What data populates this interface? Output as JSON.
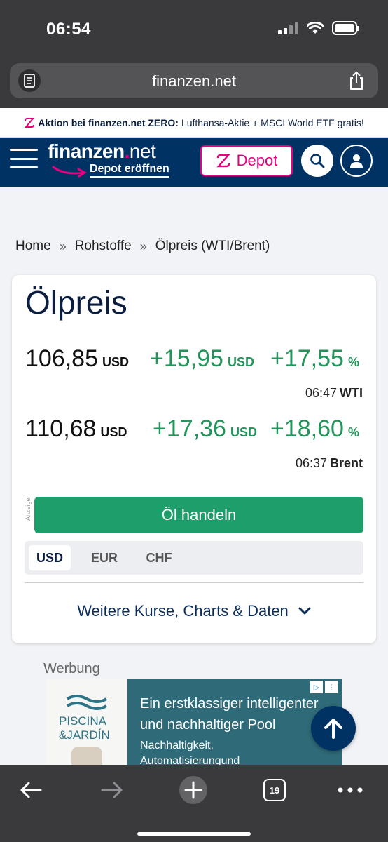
{
  "status": {
    "time": "06:54"
  },
  "browser": {
    "url": "finanzen.net",
    "tabs_count": "19"
  },
  "promo": {
    "bold": "Aktion bei finanzen.net ZERO:",
    "text": "Lufthansa-Aktie + MSCI World ETF gratis!"
  },
  "header": {
    "logo_main": "finanzen",
    "logo_dot": ".",
    "logo_net": "net",
    "logo_sub": "Depot eröffnen",
    "depot_label": "Depot"
  },
  "breadcrumb": [
    "Home",
    "Rohstoffe",
    "Ölpreis (WTI/Brent)"
  ],
  "breadcrumb_sep": "»",
  "card": {
    "title": "Ölpreis",
    "quotes": [
      {
        "price": "106,85",
        "price_unit": "USD",
        "change": "+15,95",
        "change_unit": "USD",
        "pct": "+17,55",
        "pct_unit": "%",
        "time": "06:47",
        "name": "WTI"
      },
      {
        "price": "110,68",
        "price_unit": "USD",
        "change": "+17,36",
        "change_unit": "USD",
        "pct": "+18,60",
        "pct_unit": "%",
        "time": "06:37",
        "name": "Brent"
      }
    ],
    "anzeige": "Anzeige",
    "trade_label": "Öl handeln",
    "currencies": [
      "USD",
      "EUR",
      "CHF"
    ],
    "more_label": "Weitere Kurse, Charts & Daten"
  },
  "ad": {
    "label": "Werbung",
    "brand_line1": "PISCINA",
    "brand_line2": "&JARDÍN",
    "headline": "Ein erstklassiger intelligenter und nachhaltiger Pool",
    "body": "Nachhaltigkeit, Automatisierungund"
  },
  "colors": {
    "brand_navy": "#003263",
    "accent_pink": "#e6007e",
    "positive_green": "#22955a",
    "trade_green": "#1e9e6a"
  }
}
